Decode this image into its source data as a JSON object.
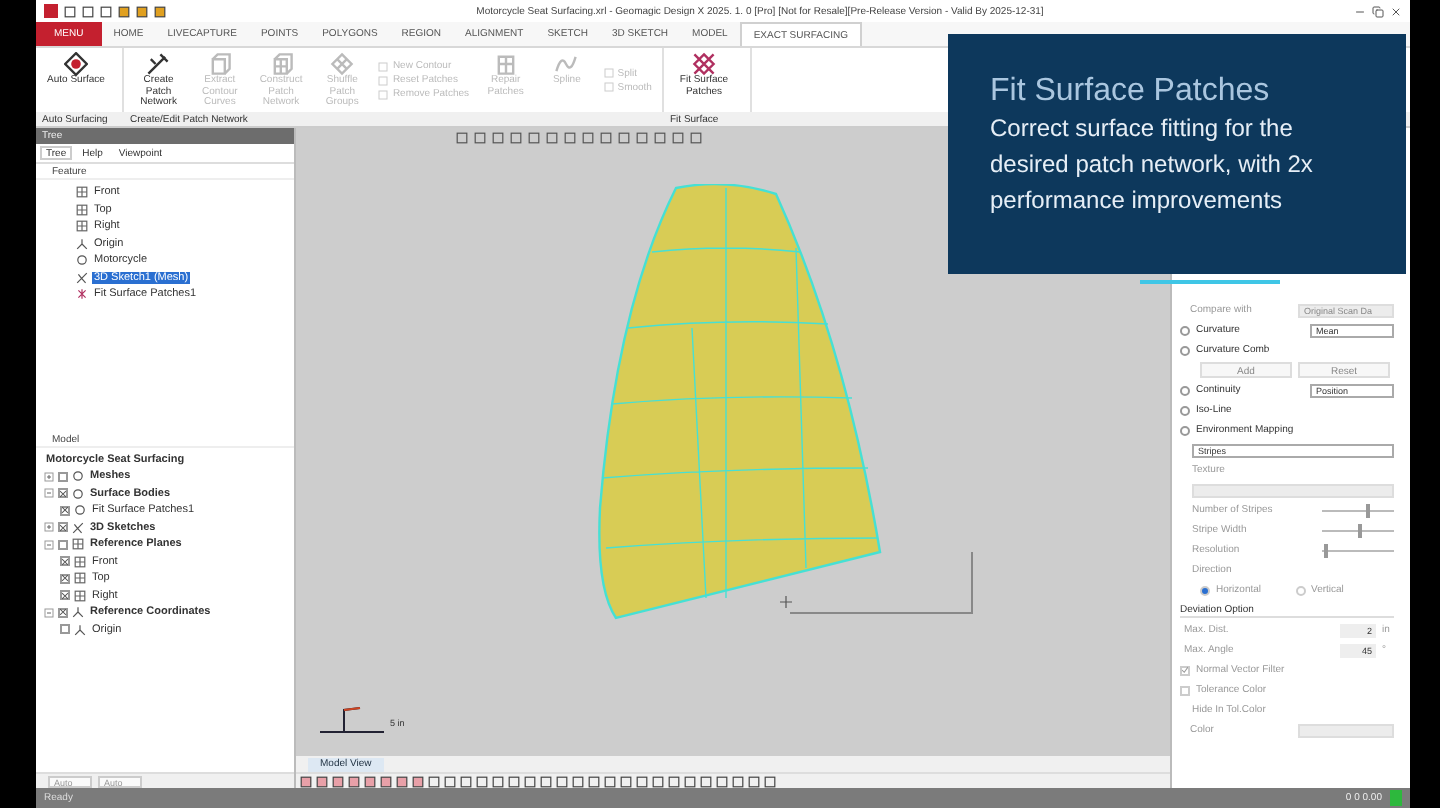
{
  "window": {
    "title": "Motorcycle Seat Surfacing.xrl - Geomagic Design X 2025. 1. 0 [Pro] [Not for Resale][Pre-Release Version - Valid By 2025-12-31]"
  },
  "ribbon_tabs": [
    {
      "label": "MENU",
      "kind": "menu",
      "selected": false
    },
    {
      "label": "HOME",
      "kind": "tab",
      "selected": false
    },
    {
      "label": "LIVECAPTURE",
      "kind": "tab",
      "selected": false
    },
    {
      "label": "POINTS",
      "kind": "tab",
      "selected": false
    },
    {
      "label": "POLYGONS",
      "kind": "tab",
      "selected": false
    },
    {
      "label": "REGION",
      "kind": "tab",
      "selected": false
    },
    {
      "label": "ALIGNMENT",
      "kind": "tab",
      "selected": false
    },
    {
      "label": "SKETCH",
      "kind": "tab",
      "selected": false
    },
    {
      "label": "3D SKETCH",
      "kind": "tab",
      "selected": false
    },
    {
      "label": "MODEL",
      "kind": "tab",
      "selected": false
    },
    {
      "label": "EXACT SURFACING",
      "kind": "tab",
      "selected": true
    }
  ],
  "ribbon_groups": [
    {
      "label": "Auto Surfacing",
      "tools": [
        {
          "kind": "large",
          "label": "Auto Surface",
          "disabled": false
        }
      ]
    },
    {
      "label": "Create/Edit Patch Network",
      "tools": [
        {
          "kind": "large",
          "label": "Create Patch Network",
          "disabled": false
        },
        {
          "kind": "large",
          "label": "Extract Contour Curves",
          "disabled": true
        },
        {
          "kind": "large",
          "label": "Construct Patch Network",
          "disabled": true
        },
        {
          "kind": "large",
          "label": "Shuffle Patch Groups",
          "disabled": true
        },
        {
          "kind": "stack",
          "items": [
            {
              "label": "New Contour",
              "disabled": true
            },
            {
              "label": "Reset Patches",
              "disabled": true
            },
            {
              "label": "Remove Patches",
              "disabled": true
            }
          ]
        },
        {
          "kind": "large",
          "label": "Repair Patches",
          "disabled": true
        },
        {
          "kind": "large",
          "label": "Spline",
          "disabled": true
        },
        {
          "kind": "stack",
          "items": [
            {
              "label": "Split",
              "disabled": true
            },
            {
              "label": "Smooth",
              "disabled": true
            }
          ]
        }
      ]
    },
    {
      "label": "Fit Surface",
      "tools": [
        {
          "kind": "large",
          "label": "Fit Surface Patches",
          "disabled": false
        }
      ]
    }
  ],
  "overlay": {
    "title": "Fit Surface Patches",
    "body_lines": [
      "Correct surface fitting for the",
      "desired patch network, with 2x",
      "performance improvements"
    ]
  },
  "tree_panel": {
    "title": "Tree",
    "tabs": [
      {
        "label": "Tree",
        "selected": true
      },
      {
        "label": "Help",
        "selected": false
      },
      {
        "label": "Viewpoint",
        "selected": false
      }
    ],
    "feature_header": "Feature",
    "features": [
      {
        "label": "Front",
        "kind": "plane",
        "selected": false
      },
      {
        "label": "Top",
        "kind": "plane",
        "selected": false
      },
      {
        "label": "Right",
        "kind": "plane",
        "selected": false
      },
      {
        "label": "Origin",
        "kind": "origin",
        "selected": false
      },
      {
        "label": "Motorcycle",
        "kind": "mesh",
        "selected": false
      },
      {
        "label": "3D Sketch1 (Mesh)",
        "kind": "sketch",
        "selected": true
      },
      {
        "label": "Fit Surface Patches1",
        "kind": "patches",
        "selected": false
      }
    ],
    "model_header": "Model",
    "model": {
      "label": "Motorcycle Seat Surfacing",
      "children": [
        {
          "label": "Meshes",
          "kind": "mesh",
          "checked": false,
          "expanded": false
        },
        {
          "label": "Surface Bodies",
          "kind": "surface",
          "checked": true,
          "expanded": true,
          "children": [
            {
              "label": "Fit Surface Patches1",
              "kind": "surface",
              "checked": true
            }
          ]
        },
        {
          "label": "3D Sketches",
          "kind": "sketch",
          "checked": true,
          "expanded": false
        },
        {
          "label": "Reference Planes",
          "kind": "plane",
          "checked": false,
          "expanded": true,
          "children": [
            {
              "label": "Front",
              "kind": "plane",
              "checked": true
            },
            {
              "label": "Top",
              "kind": "plane",
              "checked": true
            },
            {
              "label": "Right",
              "kind": "plane",
              "checked": true
            }
          ]
        },
        {
          "label": "Reference Coordinates",
          "kind": "origin",
          "checked": true,
          "expanded": true,
          "children": [
            {
              "label": "Origin",
              "kind": "origin",
              "checked": false
            }
          ]
        }
      ]
    },
    "toolbar_fields": [
      "Auto",
      "Auto"
    ]
  },
  "viewport": {
    "scale_label": "5 in",
    "tab": "Model View"
  },
  "properties": [
    {
      "kind": "field",
      "label": "Compare with",
      "value": "Original Scan Da",
      "disabled": true
    },
    {
      "kind": "option",
      "label": "Curvature",
      "value": "Mean",
      "checked": false
    },
    {
      "kind": "option",
      "label": "Curvature Comb",
      "checked": false
    },
    {
      "kind": "buttons",
      "buttons": [
        "Add",
        "Reset"
      ],
      "disabled": true
    },
    {
      "kind": "option",
      "label": "Continuity",
      "value": "Position",
      "checked": false
    },
    {
      "kind": "option",
      "label": "Iso-Line",
      "checked": false
    },
    {
      "kind": "option",
      "label": "Environment Mapping",
      "checked": false
    },
    {
      "kind": "dropdown",
      "value": "Stripes",
      "disabled": false
    },
    {
      "kind": "label",
      "label": "Texture",
      "disabled": true
    },
    {
      "kind": "dropdown",
      "disabled": true
    },
    {
      "kind": "slider",
      "label": "Number of Stripes",
      "level": 0.6
    },
    {
      "kind": "slider",
      "label": "Stripe Width",
      "level": 0.5
    },
    {
      "kind": "slider",
      "label": "Resolution",
      "level": 0.03
    },
    {
      "kind": "label",
      "label": "Direction",
      "disabled": true
    },
    {
      "kind": "radios",
      "options": [
        {
          "label": "Horizontal",
          "selected": true
        },
        {
          "label": "Vertical",
          "selected": false
        }
      ]
    },
    {
      "kind": "section",
      "label": "Deviation Option"
    },
    {
      "kind": "number",
      "label": "Max. Dist.",
      "value": "2",
      "unit": "in"
    },
    {
      "kind": "number",
      "label": "Max. Angle",
      "value": "45",
      "unit": "°"
    },
    {
      "kind": "checkbox",
      "label": "Normal Vector Filter",
      "checked": true,
      "disabled": true
    },
    {
      "kind": "checkbox",
      "label": "Tolerance Color",
      "checked": false,
      "disabled": true
    },
    {
      "kind": "label",
      "label": "Hide In Tol.Color",
      "disabled": true
    },
    {
      "kind": "field",
      "label": "Color",
      "disabled": true
    }
  ],
  "status_bar": {
    "text": "Ready",
    "coordinates": "0 0 0.00"
  }
}
